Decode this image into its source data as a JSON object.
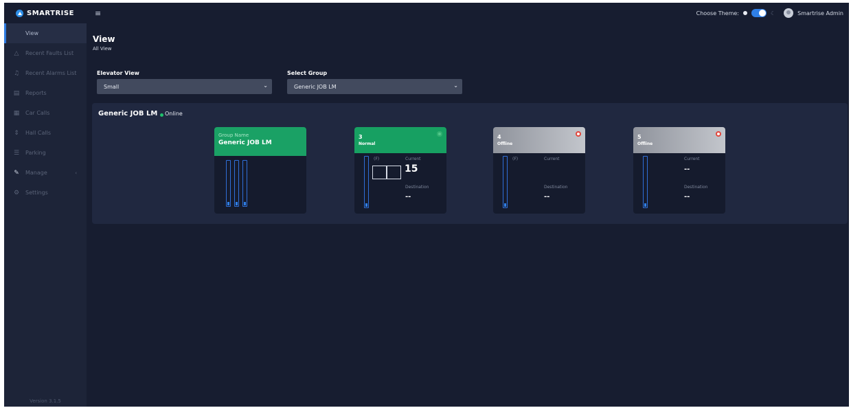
{
  "brand": {
    "name": "SMARTRISE"
  },
  "sidebar": {
    "items": [
      {
        "label": "View",
        "icon": "eye-icon"
      },
      {
        "label": "Recent Faults List",
        "icon": "warning-icon"
      },
      {
        "label": "Recent Alarms List",
        "icon": "bell-icon"
      },
      {
        "label": "Reports",
        "icon": "report-icon"
      },
      {
        "label": "Car Calls",
        "icon": "car-calls-icon"
      },
      {
        "label": "Hall Calls",
        "icon": "hall-calls-icon"
      },
      {
        "label": "Parking",
        "icon": "parking-icon"
      },
      {
        "label": "Manage",
        "icon": "wrench-icon"
      },
      {
        "label": "Settings",
        "icon": "gear-icon"
      }
    ],
    "version": "Version 3.1.5"
  },
  "header": {
    "theme_label": "Choose Theme:",
    "user_name": "Smartrise Admin"
  },
  "page": {
    "title": "View",
    "subtitle": "All View"
  },
  "filters": {
    "elevator_view_label": "Elevator View",
    "elevator_view_value": "Small",
    "select_group_label": "Select Group",
    "select_group_value": "Generic JOB LM"
  },
  "group": {
    "name": "Generic JOB LM",
    "status": "Online",
    "card": {
      "label": "Group Name",
      "value": "Generic JOB LM"
    }
  },
  "cars": [
    {
      "number": "3",
      "status": "Normal",
      "pi_label": "(F)",
      "current_label": "Current",
      "current_value": "15",
      "destination_label": "Destination",
      "destination_value": "--"
    },
    {
      "number": "4",
      "status": "Offline",
      "pi_label": "(F)",
      "current_label": "Current",
      "current_value": "",
      "destination_label": "Destination",
      "destination_value": "--"
    },
    {
      "number": "5",
      "status": "Offline",
      "current_label": "Current",
      "current_value": "--",
      "destination_label": "Destination",
      "destination_value": "--"
    }
  ],
  "colors": {
    "accent": "#2f7fe6",
    "online": "#1fbf6b",
    "normal_card": "#17a062",
    "error": "#e2453b",
    "background": "#171d30"
  }
}
